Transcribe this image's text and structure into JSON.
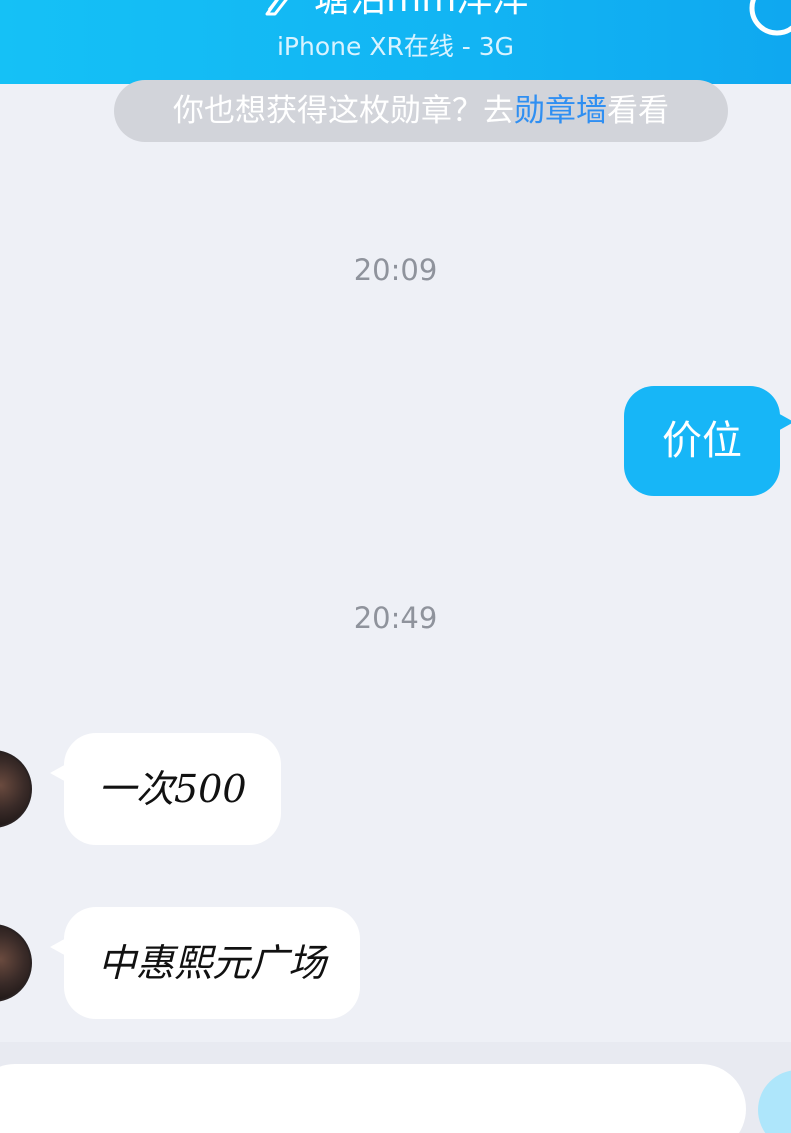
{
  "header": {
    "title": "塘沽mm洋洋",
    "subtitle": "iPhone XR在线 - 3G",
    "title_icon": "pen-icon",
    "call_icon": "phone-icon"
  },
  "medal_notice": {
    "prefix": "你也想获得这枚勋章？去",
    "link": "勋章墙",
    "suffix": "看看"
  },
  "messages": [
    {
      "type": "timestamp",
      "text": "20:09"
    },
    {
      "type": "outgoing",
      "text": "价位"
    },
    {
      "type": "timestamp",
      "text": "20:49"
    },
    {
      "type": "incoming",
      "text": "一次500"
    },
    {
      "type": "incoming",
      "text": "中惠熙元广场"
    }
  ],
  "input": {
    "value": "",
    "placeholder": ""
  },
  "colors": {
    "header": "#12b4f3",
    "outgoing_bubble": "#17b6f7",
    "incoming_bubble": "#ffffff",
    "link": "#2f8ff2",
    "background": "#eef0f6"
  }
}
